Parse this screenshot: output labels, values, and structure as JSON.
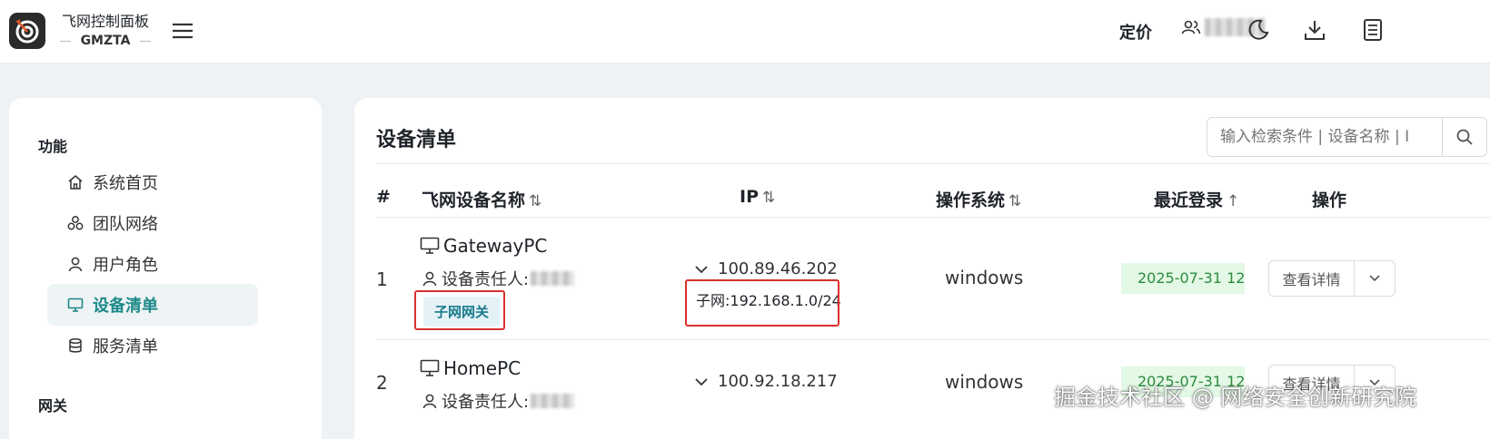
{
  "app": {
    "title": "飞网控制面板",
    "subtitle": "GMZTA"
  },
  "topbar": {
    "pricing_label": "定价"
  },
  "sidebar": {
    "groups": [
      {
        "title": "功能",
        "items": [
          {
            "label": "系统首页",
            "icon": "home-icon"
          },
          {
            "label": "团队网络",
            "icon": "network-icon"
          },
          {
            "label": "用户角色",
            "icon": "user-icon"
          },
          {
            "label": "设备清单",
            "icon": "monitor-icon",
            "active": true
          },
          {
            "label": "服务清单",
            "icon": "database-icon"
          }
        ]
      },
      {
        "title": "网关"
      }
    ]
  },
  "main": {
    "title": "设备清单",
    "search": {
      "placeholder": "输入检索条件 | 设备名称 | I"
    },
    "table": {
      "headers": [
        "#",
        "飞网设备名称",
        "IP",
        "操作系统",
        "最近登录",
        "操作"
      ],
      "sort_icons": {
        "both": "⇅",
        "asc": "↑"
      },
      "owner_label": "设备责任人:",
      "rows": [
        {
          "index": "1",
          "name": "GatewayPC",
          "tag": "子网网关",
          "ip": "100.89.46.202",
          "subnet": "子网:192.168.1.0/24",
          "os": "windows",
          "last_login": "2025-07-31 12",
          "action": "查看详情"
        },
        {
          "index": "2",
          "name": "HomePC",
          "ip": "100.92.18.217",
          "os": "windows",
          "last_login": "2025-07-31 12",
          "action": "查看详情"
        }
      ]
    }
  },
  "watermark": "掘金技术社区 @ 网络安全创新研究院",
  "colors": {
    "accent": "#1f8a8a",
    "tag_bg": "#e4f2f7",
    "date_bg": "#e3f8e5",
    "highlight_box": "#d9302c"
  }
}
